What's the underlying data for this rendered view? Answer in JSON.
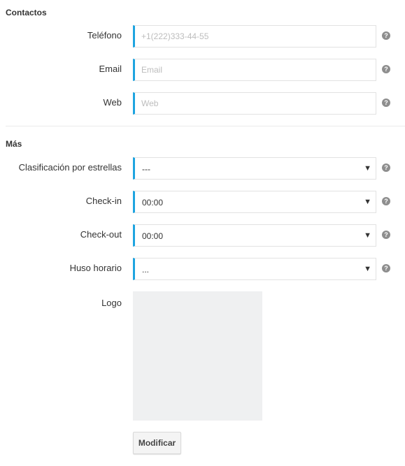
{
  "contactos": {
    "title": "Contactos",
    "phone": {
      "label": "Teléfono",
      "placeholder": "+1(222)333-44-55",
      "value": ""
    },
    "email": {
      "label": "Email",
      "placeholder": "Email",
      "value": ""
    },
    "web": {
      "label": "Web",
      "placeholder": "Web",
      "value": ""
    }
  },
  "mas": {
    "title": "Más",
    "star_rating": {
      "label": "Clasificación por estrellas",
      "selected": "---"
    },
    "check_in": {
      "label": "Check-in",
      "selected": "00:00"
    },
    "check_out": {
      "label": "Check-out",
      "selected": "00:00"
    },
    "timezone": {
      "label": "Huso horario",
      "selected": "..."
    },
    "logo": {
      "label": "Logo"
    },
    "modify_button": "Modificar"
  },
  "icons": {
    "help": "question-circle-icon",
    "caret": "caret-down-icon"
  },
  "colors": {
    "accent": "#1ea4e0",
    "placeholder": "#bdbdbd",
    "logo_background": "#eff0f1"
  }
}
